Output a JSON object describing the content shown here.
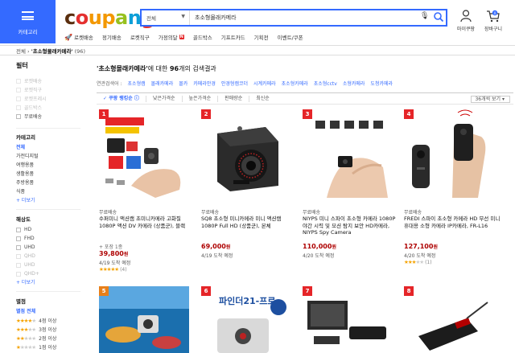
{
  "header": {
    "menu_label": "카테고리",
    "logo": [
      "c",
      "o",
      "u",
      "p",
      "a",
      "n",
      "g"
    ],
    "search_category": "전체",
    "search_value": "초소형몰래카메라",
    "mypage_label": "마이쿠팡",
    "cart_label": "장바구니",
    "cart_count": "0",
    "nav": [
      {
        "label": "로켓배송",
        "icon": "rocket-icon"
      },
      {
        "label": "정기배송",
        "icon": ""
      },
      {
        "label": "로켓직구",
        "icon": ""
      },
      {
        "label": "가정의달",
        "badge": "N",
        "icon": ""
      },
      {
        "label": "골드박스",
        "icon": ""
      },
      {
        "label": "기프트카드",
        "icon": ""
      },
      {
        "label": "기획전",
        "icon": ""
      },
      {
        "label": "이벤트/쿠폰",
        "icon": ""
      }
    ]
  },
  "breadcrumb": {
    "home": "전체",
    "sep": "›",
    "current": "'초소형몰래카메라'",
    "count": "(96)"
  },
  "sidebar": {
    "title": "필터",
    "top_filters": [
      "로켓배송",
      "로켓직구",
      "로켓프레시",
      "골드박스",
      "무료배송"
    ],
    "category_heading": "카테고리",
    "categories": [
      "전체",
      "가전디지털",
      "여행용품",
      "생활용품",
      "주방용품",
      "식품"
    ],
    "category_more": "+ 더보기",
    "resolution_heading": "해상도",
    "resolutions": [
      "HD",
      "FHD",
      "UHD",
      "QHD",
      "UHD",
      "QHD+"
    ],
    "resolution_more": "+ 더보기",
    "rating_heading": "별점",
    "rating_all": "별점 전체",
    "ratings": [
      {
        "filled": 4,
        "label": "4점 이상"
      },
      {
        "filled": 3,
        "label": "3점 이상"
      },
      {
        "filled": 2,
        "label": "2점 이상"
      },
      {
        "filled": 1,
        "label": "1점 이상"
      }
    ]
  },
  "results": {
    "query": "'초소형몰래카메라'",
    "suffix": "에 대한",
    "count": "96",
    "count_suffix": "개의 검색결과",
    "related_label": "연관검색어 :",
    "related": [
      "초소형캠",
      "몰래카메라",
      "몰카",
      "카메라안경",
      "안경형캠코더",
      "시계카메라",
      "초소형카메라",
      "초소형cctv",
      "소형카메라",
      "도청카메라"
    ],
    "sort": [
      "쿠팡 랭킹순",
      "낮은가격순",
      "높은가격순",
      "판매량순",
      "최신순"
    ],
    "per_page": "36개씩 보기"
  },
  "products": [
    {
      "rank": "1",
      "free": "무료배송",
      "name": "수퍼미니 액션캠 초미니카메라 고화질 1080P 액션 DV 카메라 (상품군), 블랙",
      "option": "+ 포장 1종",
      "price": "39,800",
      "won": "원",
      "delivery": "4/19 도착 예정",
      "stars": 5,
      "reviews": "(4)"
    },
    {
      "rank": "2",
      "free": "무료배송",
      "name": "SQ8 초소형 미니카메라 미니 액션캠 1080P Full HD (상품군), 본체",
      "option": "",
      "price": "69,000",
      "won": "원",
      "delivery": "4/19 도착 예정",
      "stars": 0,
      "reviews": ""
    },
    {
      "rank": "3",
      "free": "무료배송",
      "name": "NIYPS 미니 스파이 초소형 카메라 1080P 야간 시력 및 모션 탐지 보안 HD카메라, NIYPS Spy Camera",
      "option": "",
      "price": "110,000",
      "won": "원",
      "delivery": "4/20 도착 예정",
      "stars": 0,
      "reviews": ""
    },
    {
      "rank": "4",
      "free": "무료배송",
      "name": "FREDI 스파이 초소형 카메라 HD 무선 미니 휴대용 소형 카메라 IP카메라, FR-L16",
      "option": "",
      "price": "127,100",
      "won": "원",
      "delivery": "4/20 도착 예정",
      "stars": 3,
      "reviews": "(1)"
    },
    {
      "rank": "5"
    },
    {
      "rank": "6",
      "img_text": "파인더21-프로"
    },
    {
      "rank": "7"
    },
    {
      "rank": "8"
    }
  ]
}
